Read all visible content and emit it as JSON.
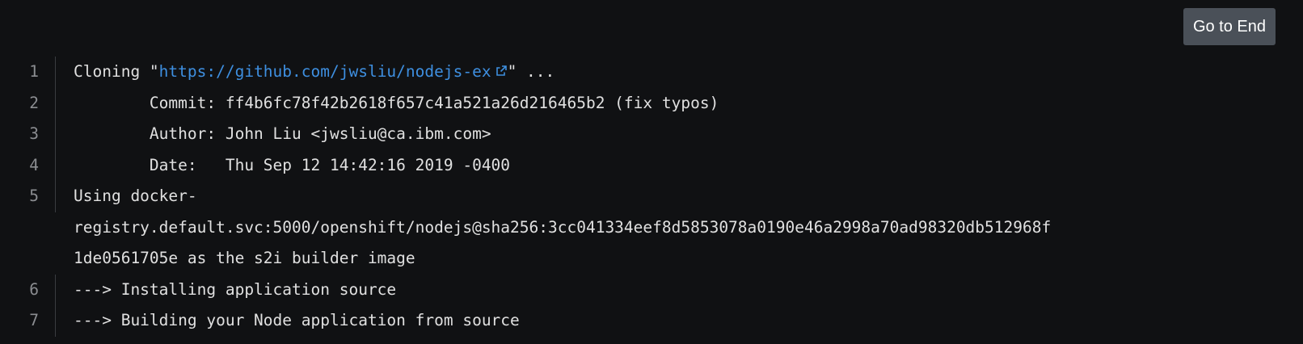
{
  "toolbar": {
    "go_to_end_label": "Go to End"
  },
  "log": {
    "line1": {
      "num": "1",
      "prefix": "Cloning \"",
      "link": "https://github.com/jwsliu/nodejs-ex",
      "suffix": "\" ..."
    },
    "line2": {
      "num": "2",
      "text": "        Commit: ff4b6fc78f42b2618f657c41a521a26d216465b2 (fix typos)"
    },
    "line3": {
      "num": "3",
      "text": "        Author: John Liu <jwsliu@ca.ibm.com>"
    },
    "line4": {
      "num": "4",
      "text": "        Date:   Thu Sep 12 14:42:16 2019 -0400"
    },
    "line5": {
      "num": "5",
      "text": "Using docker-\nregistry.default.svc:5000/openshift/nodejs@sha256:3cc041334eef8d5853078a0190e46a2998a70ad98320db512968f\n1de0561705e as the s2i builder image"
    },
    "line6": {
      "num": "6",
      "text": "---> Installing application source"
    },
    "line7": {
      "num": "7",
      "text": "---> Building your Node application from source"
    }
  },
  "colors": {
    "background": "#101113",
    "link": "#3e8fe0",
    "button": "#4a5058"
  }
}
